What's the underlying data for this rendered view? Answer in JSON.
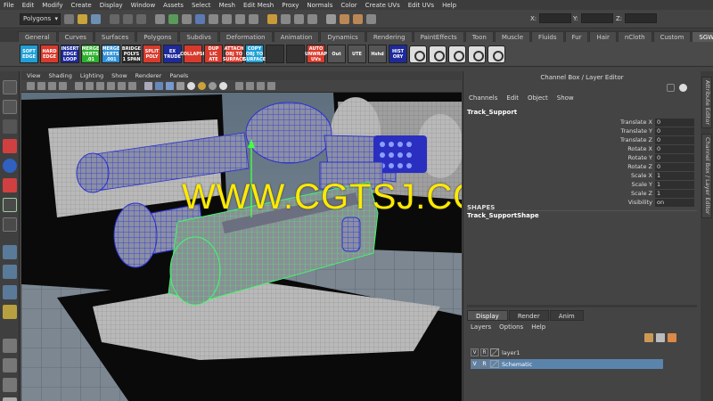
{
  "menubar": [
    "File",
    "Edit",
    "Modify",
    "Create",
    "Display",
    "Window",
    "Assets",
    "Select",
    "Mesh",
    "Edit Mesh",
    "Proxy",
    "Normals",
    "Color",
    "Create UVs",
    "Edit UVs",
    "Help"
  ],
  "status": {
    "mode": "Polygons",
    "x_label": "X:",
    "y_label": "Y:",
    "z_label": "Z:"
  },
  "shelf_tabs": [
    "General",
    "Curves",
    "Surfaces",
    "Polygons",
    "Subdivs",
    "Deformation",
    "Animation",
    "Dynamics",
    "Rendering",
    "PaintEffects",
    "Toon",
    "Muscle",
    "Fluids",
    "Fur",
    "Hair",
    "nCloth",
    "Custom",
    "SGW"
  ],
  "active_shelf_tab": "SGW",
  "shelf_buttons": [
    {
      "label": "SOFT EDGE",
      "color": "#1e9fd6"
    },
    {
      "label": "HARD EDGE",
      "color": "#d83a2c"
    },
    {
      "label": "INSERT EDGE LOOP",
      "color": "#1e2a9c"
    },
    {
      "label": "MERGE VERTS .01",
      "color": "#2cb02c"
    },
    {
      "label": "MERGE VERTS .001",
      "color": "#2d8fd8"
    },
    {
      "label": "BRIDGE POLYS 1 SPAN",
      "color": "#2a2a2a"
    },
    {
      "label": "SPLIT POLY",
      "color": "#d83a2c"
    },
    {
      "label": "EX TRUDE",
      "color": "#1e2a9c"
    },
    {
      "label": "COLLAPSE",
      "color": "#d83a2c"
    },
    {
      "label": "DUP LIC ATE",
      "color": "#d83a2c"
    },
    {
      "label": "ATTACH OBJ TO SURFACE",
      "color": "#d83a2c"
    },
    {
      "label": "COPY OBJ TO SURFACE",
      "color": "#1e9fd6"
    },
    {
      "label": "",
      "color": "#333333"
    },
    {
      "label": "",
      "color": "#333333"
    },
    {
      "label": "AUTO UNWRAP UVs",
      "color": "#d83a2c"
    },
    {
      "label": "Out",
      "color": "#555555"
    },
    {
      "label": "UTE",
      "color": "#555555"
    },
    {
      "label": "Hshd",
      "color": "#555555"
    },
    {
      "label": "HIST ORY",
      "color": "#1e2a9c"
    }
  ],
  "viewport": {
    "menu": [
      "View",
      "Shading",
      "Lighting",
      "Show",
      "Renderer",
      "Panels"
    ]
  },
  "channel_box": {
    "title": "Channel Box / Layer Editor",
    "menu": [
      "Channels",
      "Edit",
      "Object",
      "Show"
    ],
    "object": "Track_Support",
    "attributes": [
      {
        "label": "Translate X",
        "value": "0"
      },
      {
        "label": "Translate Y",
        "value": "0"
      },
      {
        "label": "Translate Z",
        "value": "0"
      },
      {
        "label": "Rotate X",
        "value": "0"
      },
      {
        "label": "Rotate Y",
        "value": "0"
      },
      {
        "label": "Rotate Z",
        "value": "0"
      },
      {
        "label": "Scale X",
        "value": "1"
      },
      {
        "label": "Scale Y",
        "value": "1"
      },
      {
        "label": "Scale Z",
        "value": "1"
      },
      {
        "label": "Visibility",
        "value": "on"
      }
    ],
    "shape_header": "SHAPES",
    "shape": "Track_SupportShape"
  },
  "layer_editor": {
    "tabs": [
      "Display",
      "Render",
      "Anim"
    ],
    "active_tab": "Display",
    "menu": [
      "Layers",
      "Options",
      "Help"
    ],
    "layers": [
      {
        "v": "V",
        "r": "R",
        "name": "layer1",
        "selected": false
      },
      {
        "v": "V",
        "r": "R",
        "name": "Schematic",
        "selected": true
      }
    ]
  },
  "side_tabs": [
    "Attribute Editor",
    "Channel Box / Layer Editor"
  ],
  "watermark": "WWW.CGTSJ.COM",
  "colors": {
    "selection_blue": "#5b84ad",
    "wire_blue": "#2b2fd0",
    "wire_green": "#3cff6a"
  }
}
